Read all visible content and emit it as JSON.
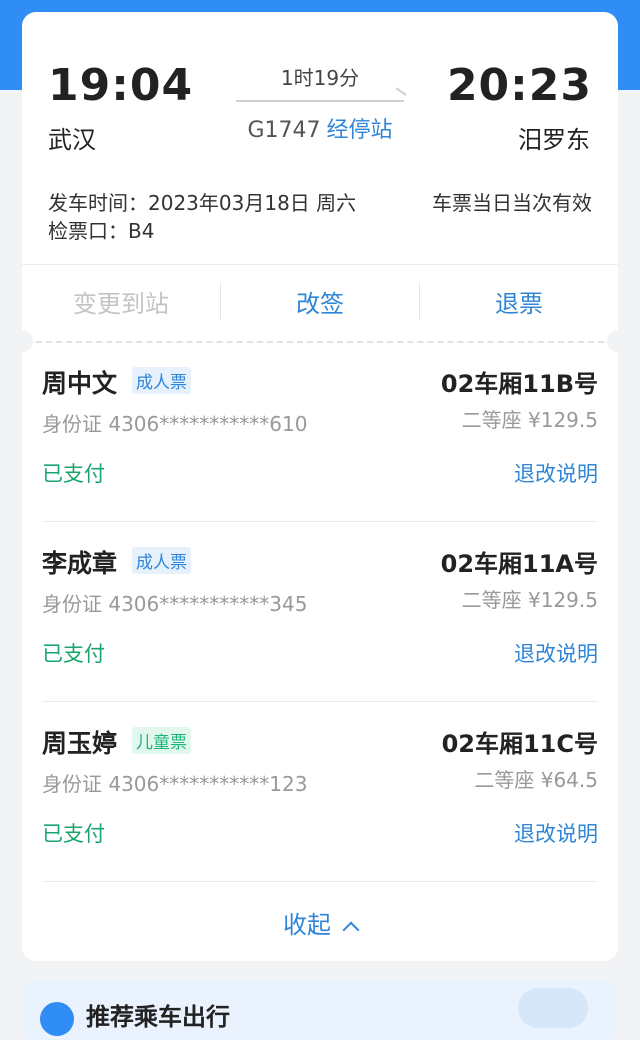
{
  "trip": {
    "departure_time": "19:04",
    "arrival_time": "20:23",
    "departure_station": "武汉",
    "arrival_station": "汨罗东",
    "duration": "1时19分",
    "train_no": "G1747",
    "stops_link": "经停站",
    "depart_date": "发车时间：2023年03月18日 周六",
    "validity": "车票当日当次有效",
    "gate": "检票口：B4"
  },
  "actions": {
    "change_station": "变更到站",
    "reschedule": "改签",
    "refund": "退票"
  },
  "passengers": [
    {
      "name": "周中文",
      "type": "成人票",
      "seat": "02车厢11B号",
      "id": "身份证 4306***********610",
      "price": "二等座 ¥129.5",
      "status": "已支付",
      "rules": "退改说明"
    },
    {
      "name": "李成章",
      "type": "成人票",
      "seat": "02车厢11A号",
      "id": "身份证 4306***********345",
      "price": "二等座 ¥129.5",
      "status": "已支付",
      "rules": "退改说明"
    },
    {
      "name": "周玉婷",
      "type": "儿童票",
      "seat": "02车厢11C号",
      "id": "身份证 4306***********123",
      "price": "二等座 ¥64.5",
      "status": "已支付",
      "rules": "退改说明"
    }
  ],
  "collapse_label": "收起",
  "promo": {
    "text": "推荐乘车出行"
  },
  "colors": {
    "brand_blue": "#2f8df5",
    "link_blue": "#2f86d8",
    "paid_green": "#1aa56f",
    "child_green": "#1db57d"
  }
}
